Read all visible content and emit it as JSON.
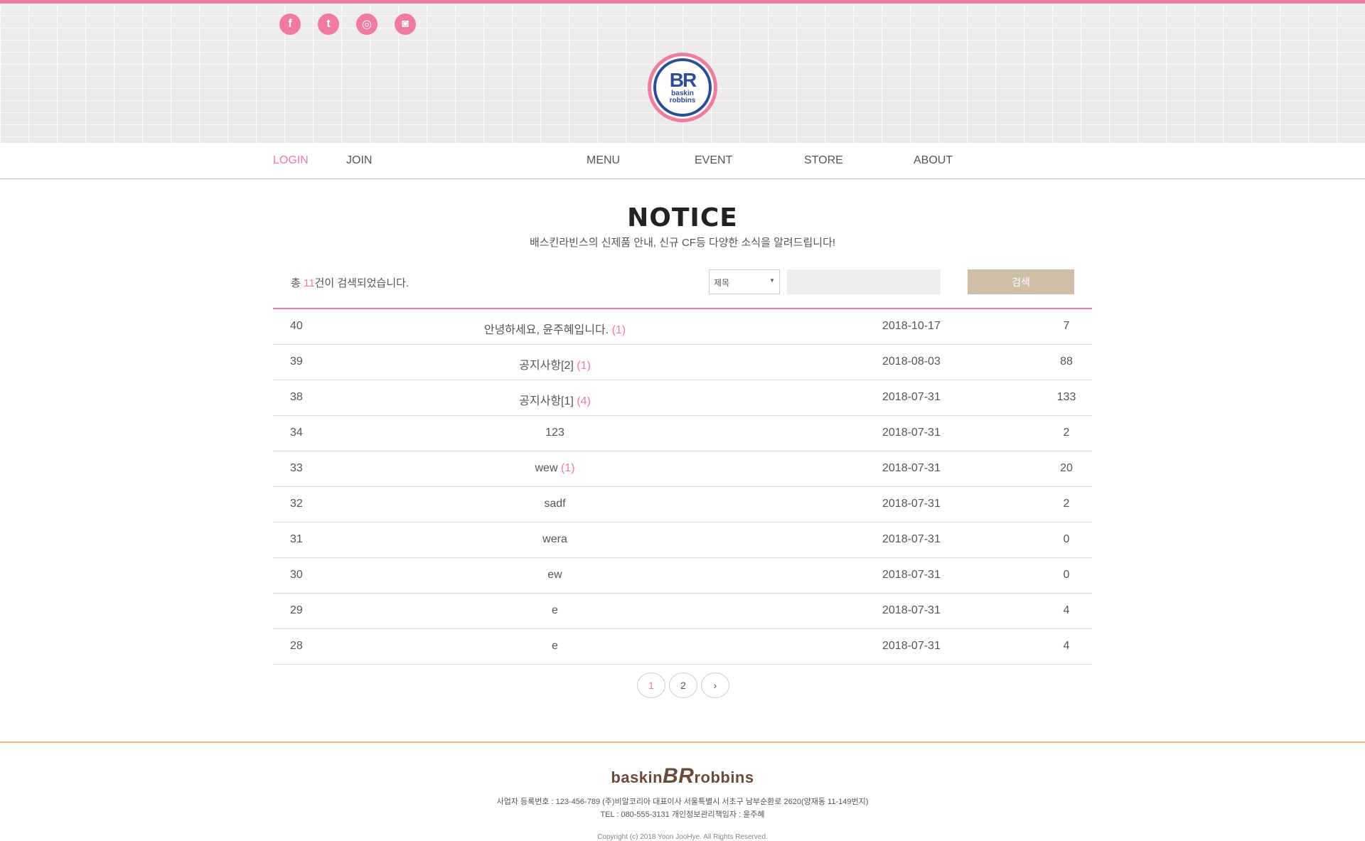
{
  "header": {
    "social": [
      "f",
      "t",
      "◎",
      "◙"
    ],
    "logo": {
      "mark": "BR",
      "text1": "baskin",
      "text2": "robbins"
    }
  },
  "nav": {
    "login": "LOGIN",
    "join": "JOIN",
    "menu": "MENU",
    "event": "EVENT",
    "store": "STORE",
    "about": "ABOUT"
  },
  "page": {
    "title": "NOTICE",
    "subtitle": "배스킨라빈스의 신제품 안내, 신규 CF등 다양한 소식을 알려드립니다!"
  },
  "search": {
    "count_prefix": "총 ",
    "count": "11",
    "count_suffix": "건이 검색되었습니다.",
    "select_value": "제목",
    "button": "검색"
  },
  "rows": [
    {
      "no": "40",
      "title": "안녕하세요, 윤주혜입니다.",
      "comments": "(1)",
      "date": "2018-10-17",
      "views": "7"
    },
    {
      "no": "39",
      "title": "공지사항[2]",
      "comments": "(1)",
      "date": "2018-08-03",
      "views": "88"
    },
    {
      "no": "38",
      "title": "공지사항[1]",
      "comments": "(4)",
      "date": "2018-07-31",
      "views": "133"
    },
    {
      "no": "34",
      "title": "123",
      "comments": "",
      "date": "2018-07-31",
      "views": "2"
    },
    {
      "no": "33",
      "title": "wew",
      "comments": "(1)",
      "date": "2018-07-31",
      "views": "20"
    },
    {
      "no": "32",
      "title": "sadf",
      "comments": "",
      "date": "2018-07-31",
      "views": "2"
    },
    {
      "no": "31",
      "title": "wera",
      "comments": "",
      "date": "2018-07-31",
      "views": "0"
    },
    {
      "no": "30",
      "title": "ew",
      "comments": "",
      "date": "2018-07-31",
      "views": "0"
    },
    {
      "no": "29",
      "title": "e",
      "comments": "",
      "date": "2018-07-31",
      "views": "4"
    },
    {
      "no": "28",
      "title": "e",
      "comments": "",
      "date": "2018-07-31",
      "views": "4"
    }
  ],
  "pager": {
    "p1": "1",
    "p2": "2",
    "next": "›"
  },
  "footer": {
    "logo_left": "baskin",
    "logo_mark": "BR",
    "logo_right": "robbins",
    "line1": "사업자 등록번호 : 123-456-789    (주)비알코리아 대표이사    서울특별시 서초구 남부순환로 2620(양재동 11-149번지)",
    "line2": "TEL : 080-555-3131    개인정보관리책임자 : 윤주혜",
    "copyright": "Copyright (c) 2018 Yoon JooHye. All Rights Reserved."
  }
}
